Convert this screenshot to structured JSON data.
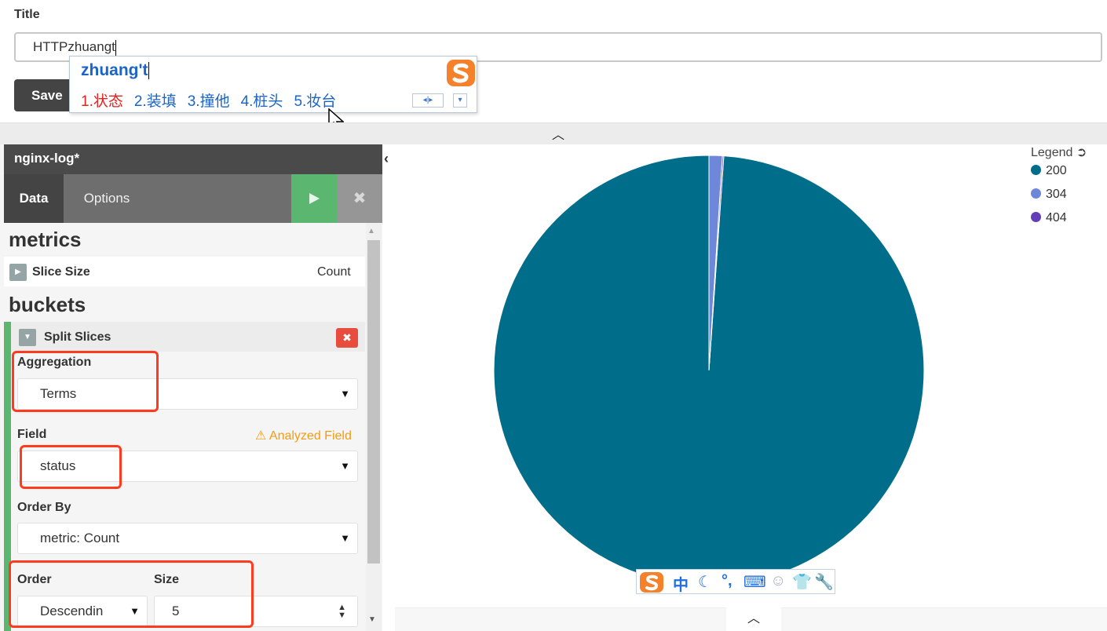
{
  "save_form": {
    "title_label": "Title",
    "title_value": "HTTPzhuangt",
    "save_label": "Save"
  },
  "ime_popup": {
    "composition": "zhuang't",
    "candidates": [
      "1.状态",
      "2.装填",
      "3.撞他",
      "4.桩头",
      "5.妆台"
    ]
  },
  "sidebar": {
    "index_pattern": "nginx-log*",
    "tabs": {
      "data": "Data",
      "options": "Options"
    },
    "metrics": {
      "heading": "metrics",
      "row_label": "Slice Size",
      "row_value": "Count"
    },
    "buckets": {
      "heading": "buckets",
      "split_label": "Split Slices",
      "aggregation_label": "Aggregation",
      "aggregation_value": "Terms",
      "field_label": "Field",
      "field_warning": "Analyzed Field",
      "field_value": "status",
      "order_by_label": "Order By",
      "order_by_value": "metric: Count",
      "order_label": "Order",
      "order_value": "Descendin",
      "size_label": "Size",
      "size_value": "5"
    }
  },
  "legend": {
    "title": "Legend",
    "items": [
      {
        "label": "200",
        "color": "#006e8a"
      },
      {
        "label": "304",
        "color": "#6f87d8"
      },
      {
        "label": "404",
        "color": "#663db8"
      }
    ]
  },
  "chart_data": {
    "type": "pie",
    "categories": [
      "200",
      "304",
      "404"
    ],
    "values": [
      98.9,
      1.0,
      0.1
    ],
    "colors": [
      "#006e8a",
      "#6f87d8",
      "#663db8"
    ],
    "title": "",
    "legend_position": "top-right"
  },
  "ime_toolbar": {
    "icons": [
      "sogou-logo-icon",
      "chinese-mode-icon",
      "moon-icon",
      "punctuation-icon",
      "keyboard-icon",
      "user-icon",
      "skin-icon",
      "wrench-icon"
    ],
    "mode_label": "中"
  }
}
